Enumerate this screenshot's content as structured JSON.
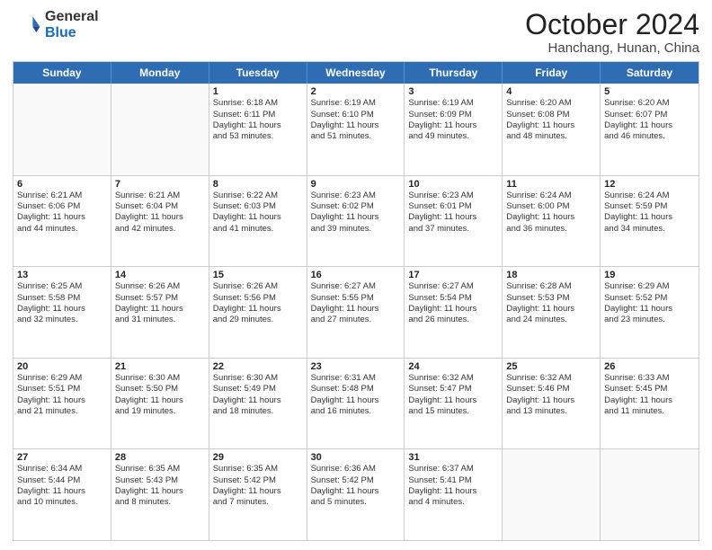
{
  "header": {
    "logo_general": "General",
    "logo_blue": "Blue",
    "month_title": "October 2024",
    "location": "Hanchang, Hunan, China"
  },
  "weekdays": [
    "Sunday",
    "Monday",
    "Tuesday",
    "Wednesday",
    "Thursday",
    "Friday",
    "Saturday"
  ],
  "rows": [
    [
      {
        "day": "",
        "sunrise": "",
        "sunset": "",
        "daylight": ""
      },
      {
        "day": "",
        "sunrise": "",
        "sunset": "",
        "daylight": ""
      },
      {
        "day": "1",
        "sunrise": "Sunrise: 6:18 AM",
        "sunset": "Sunset: 6:11 PM",
        "daylight": "Daylight: 11 hours and 53 minutes."
      },
      {
        "day": "2",
        "sunrise": "Sunrise: 6:19 AM",
        "sunset": "Sunset: 6:10 PM",
        "daylight": "Daylight: 11 hours and 51 minutes."
      },
      {
        "day": "3",
        "sunrise": "Sunrise: 6:19 AM",
        "sunset": "Sunset: 6:09 PM",
        "daylight": "Daylight: 11 hours and 49 minutes."
      },
      {
        "day": "4",
        "sunrise": "Sunrise: 6:20 AM",
        "sunset": "Sunset: 6:08 PM",
        "daylight": "Daylight: 11 hours and 48 minutes."
      },
      {
        "day": "5",
        "sunrise": "Sunrise: 6:20 AM",
        "sunset": "Sunset: 6:07 PM",
        "daylight": "Daylight: 11 hours and 46 minutes."
      }
    ],
    [
      {
        "day": "6",
        "sunrise": "Sunrise: 6:21 AM",
        "sunset": "Sunset: 6:06 PM",
        "daylight": "Daylight: 11 hours and 44 minutes."
      },
      {
        "day": "7",
        "sunrise": "Sunrise: 6:21 AM",
        "sunset": "Sunset: 6:04 PM",
        "daylight": "Daylight: 11 hours and 42 minutes."
      },
      {
        "day": "8",
        "sunrise": "Sunrise: 6:22 AM",
        "sunset": "Sunset: 6:03 PM",
        "daylight": "Daylight: 11 hours and 41 minutes."
      },
      {
        "day": "9",
        "sunrise": "Sunrise: 6:23 AM",
        "sunset": "Sunset: 6:02 PM",
        "daylight": "Daylight: 11 hours and 39 minutes."
      },
      {
        "day": "10",
        "sunrise": "Sunrise: 6:23 AM",
        "sunset": "Sunset: 6:01 PM",
        "daylight": "Daylight: 11 hours and 37 minutes."
      },
      {
        "day": "11",
        "sunrise": "Sunrise: 6:24 AM",
        "sunset": "Sunset: 6:00 PM",
        "daylight": "Daylight: 11 hours and 36 minutes."
      },
      {
        "day": "12",
        "sunrise": "Sunrise: 6:24 AM",
        "sunset": "Sunset: 5:59 PM",
        "daylight": "Daylight: 11 hours and 34 minutes."
      }
    ],
    [
      {
        "day": "13",
        "sunrise": "Sunrise: 6:25 AM",
        "sunset": "Sunset: 5:58 PM",
        "daylight": "Daylight: 11 hours and 32 minutes."
      },
      {
        "day": "14",
        "sunrise": "Sunrise: 6:26 AM",
        "sunset": "Sunset: 5:57 PM",
        "daylight": "Daylight: 11 hours and 31 minutes."
      },
      {
        "day": "15",
        "sunrise": "Sunrise: 6:26 AM",
        "sunset": "Sunset: 5:56 PM",
        "daylight": "Daylight: 11 hours and 29 minutes."
      },
      {
        "day": "16",
        "sunrise": "Sunrise: 6:27 AM",
        "sunset": "Sunset: 5:55 PM",
        "daylight": "Daylight: 11 hours and 27 minutes."
      },
      {
        "day": "17",
        "sunrise": "Sunrise: 6:27 AM",
        "sunset": "Sunset: 5:54 PM",
        "daylight": "Daylight: 11 hours and 26 minutes."
      },
      {
        "day": "18",
        "sunrise": "Sunrise: 6:28 AM",
        "sunset": "Sunset: 5:53 PM",
        "daylight": "Daylight: 11 hours and 24 minutes."
      },
      {
        "day": "19",
        "sunrise": "Sunrise: 6:29 AM",
        "sunset": "Sunset: 5:52 PM",
        "daylight": "Daylight: 11 hours and 23 minutes."
      }
    ],
    [
      {
        "day": "20",
        "sunrise": "Sunrise: 6:29 AM",
        "sunset": "Sunset: 5:51 PM",
        "daylight": "Daylight: 11 hours and 21 minutes."
      },
      {
        "day": "21",
        "sunrise": "Sunrise: 6:30 AM",
        "sunset": "Sunset: 5:50 PM",
        "daylight": "Daylight: 11 hours and 19 minutes."
      },
      {
        "day": "22",
        "sunrise": "Sunrise: 6:30 AM",
        "sunset": "Sunset: 5:49 PM",
        "daylight": "Daylight: 11 hours and 18 minutes."
      },
      {
        "day": "23",
        "sunrise": "Sunrise: 6:31 AM",
        "sunset": "Sunset: 5:48 PM",
        "daylight": "Daylight: 11 hours and 16 minutes."
      },
      {
        "day": "24",
        "sunrise": "Sunrise: 6:32 AM",
        "sunset": "Sunset: 5:47 PM",
        "daylight": "Daylight: 11 hours and 15 minutes."
      },
      {
        "day": "25",
        "sunrise": "Sunrise: 6:32 AM",
        "sunset": "Sunset: 5:46 PM",
        "daylight": "Daylight: 11 hours and 13 minutes."
      },
      {
        "day": "26",
        "sunrise": "Sunrise: 6:33 AM",
        "sunset": "Sunset: 5:45 PM",
        "daylight": "Daylight: 11 hours and 11 minutes."
      }
    ],
    [
      {
        "day": "27",
        "sunrise": "Sunrise: 6:34 AM",
        "sunset": "Sunset: 5:44 PM",
        "daylight": "Daylight: 11 hours and 10 minutes."
      },
      {
        "day": "28",
        "sunrise": "Sunrise: 6:35 AM",
        "sunset": "Sunset: 5:43 PM",
        "daylight": "Daylight: 11 hours and 8 minutes."
      },
      {
        "day": "29",
        "sunrise": "Sunrise: 6:35 AM",
        "sunset": "Sunset: 5:42 PM",
        "daylight": "Daylight: 11 hours and 7 minutes."
      },
      {
        "day": "30",
        "sunrise": "Sunrise: 6:36 AM",
        "sunset": "Sunset: 5:42 PM",
        "daylight": "Daylight: 11 hours and 5 minutes."
      },
      {
        "day": "31",
        "sunrise": "Sunrise: 6:37 AM",
        "sunset": "Sunset: 5:41 PM",
        "daylight": "Daylight: 11 hours and 4 minutes."
      },
      {
        "day": "",
        "sunrise": "",
        "sunset": "",
        "daylight": ""
      },
      {
        "day": "",
        "sunrise": "",
        "sunset": "",
        "daylight": ""
      }
    ]
  ]
}
